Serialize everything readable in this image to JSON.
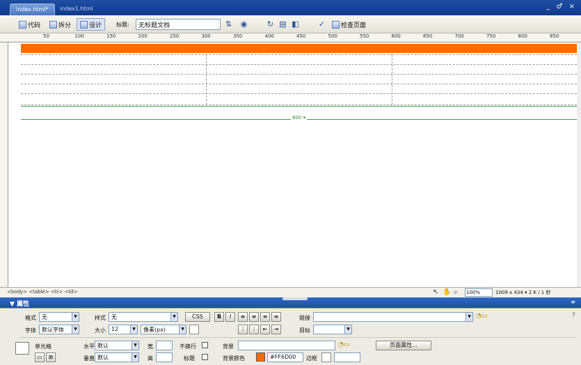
{
  "tabs": [
    {
      "label": "index.html*"
    },
    {
      "label": "index1.html"
    }
  ],
  "window_controls": "_ ♂ ×",
  "toolbar": {
    "code_label": "代码",
    "split_label": "拆分",
    "design_label": "设计",
    "title_label": "标题:",
    "title_value": "无标题文档",
    "check_page_label": "检查页面"
  },
  "ruler": {
    "marks": [
      "50",
      "100",
      "150",
      "200",
      "250",
      "300",
      "350",
      "400",
      "450",
      "500",
      "550",
      "600",
      "650",
      "700",
      "750",
      "800",
      "850"
    ]
  },
  "canvas": {
    "table_width_label": "800 ▾",
    "accent_color": "#ff6d00"
  },
  "status": {
    "tag_path": "<body> <table> <tr> <td>",
    "zoom": "100%",
    "dims": "1009 x 434 ▾ 2 K / 1 秒"
  },
  "properties": {
    "header": "▼ 属性",
    "format_label": "格式",
    "format_value": "无",
    "style_label": "样式",
    "style_value": "无",
    "css_button": "CSS",
    "link_label": "链接",
    "font_label": "字体",
    "font_value": "默认字体",
    "size_label": "大小",
    "size_value": "12",
    "unit_value": "像素(px)",
    "target_label": "目标",
    "cell_label": "单元格",
    "horz_label": "水平",
    "horz_value": "默认",
    "vert_label": "垂直",
    "vert_value": "默认",
    "w_label": "宽",
    "h_label": "高",
    "nowrap_label": "不换行",
    "header_cb_label": "标题",
    "bg_label": "背景",
    "bgcolor_label": "背景颜色",
    "bgcolor_value": "#FF6D00",
    "border_label": "边框",
    "page_props_button": "页面属性..."
  }
}
